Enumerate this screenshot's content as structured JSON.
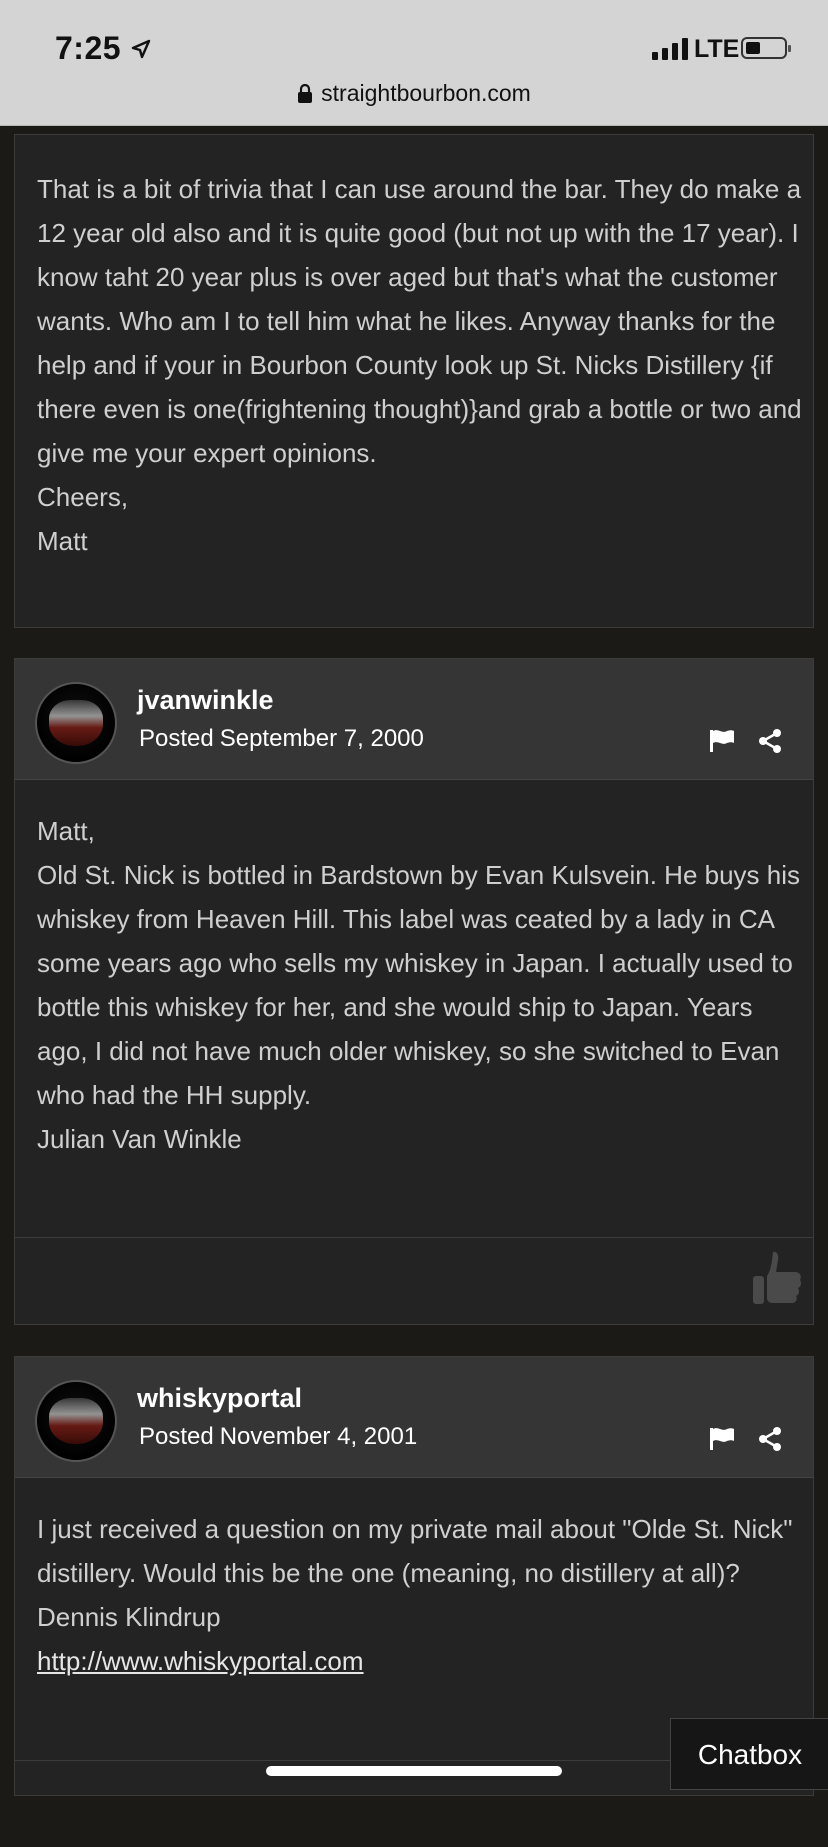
{
  "status_bar": {
    "time": "7:25",
    "network": "LTE"
  },
  "browser": {
    "url": "straightbourbon.com"
  },
  "colors": {
    "page_bg": "#1c1a17",
    "post_bg": "#232323",
    "header_bg": "#353535",
    "text": "#cfcfcf"
  },
  "posts": [
    {
      "body_lines": [
        "That is a bit of trivia that I can use around the bar. They do make a 12 year old also and it is quite good (but not up with the 17 year). I know taht 20 year plus is over aged but that's what the customer wants. Who am I to tell him what he likes. Anyway thanks for the help and if your in Bourbon County look up St. Nicks Distillery {if there even is one(frightening thought)}and grab a bottle or two and give me your expert opinions.",
        "Cheers,",
        "Matt"
      ]
    },
    {
      "username": "jvanwinkle",
      "posted_label": "Posted",
      "posted_date": "September 7, 2000",
      "body_lines": [
        "Matt,",
        "Old St. Nick is bottled in Bardstown by Evan Kulsvein. He buys his whiskey from Heaven Hill. This label was ceated by a lady in CA some years ago who sells my whiskey in Japan. I actually used to bottle this whiskey for her, and she would ship to Japan. Years ago, I did not have much older whiskey, so she switched to Evan who had the HH supply.",
        "Julian Van Winkle"
      ]
    },
    {
      "username": "whiskyportal",
      "posted_label": "Posted",
      "posted_date": "November 4, 2001",
      "body_lines": [
        "I just received a question on my private mail about \"Olde St. Nick\" distillery. Would this be the one (meaning, no distillery at all)?",
        "Dennis Klindrup"
      ],
      "link": "http://www.whiskyportal.com"
    }
  ],
  "chatbox": {
    "label": "Chatbox"
  }
}
